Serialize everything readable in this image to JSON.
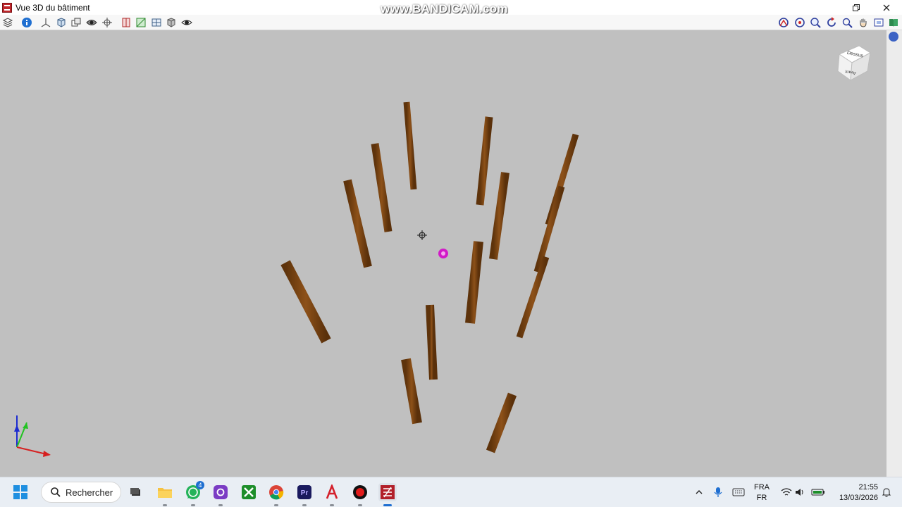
{
  "window": {
    "title": "Vue 3D du bâtiment"
  },
  "watermark": "www.BANDICAM.com",
  "toolbar_left": [
    {
      "icon": "layers-icon"
    },
    {
      "icon": "info-icon"
    },
    {
      "icon": "axes-icon"
    },
    {
      "icon": "box-view-icon"
    },
    {
      "icon": "copy-view-icon"
    },
    {
      "icon": "eye-hide-icon"
    },
    {
      "icon": "walk-icon"
    },
    {
      "icon": "section-icon"
    },
    {
      "icon": "plane-icon"
    },
    {
      "icon": "grid-icon"
    },
    {
      "icon": "cube-icon"
    },
    {
      "icon": "eye-icon"
    }
  ],
  "toolbar_right": [
    {
      "icon": "orbit-icon"
    },
    {
      "icon": "orbit-free-icon"
    },
    {
      "icon": "zoom-icon"
    },
    {
      "icon": "rotate-icon"
    },
    {
      "icon": "zoom-window-icon"
    },
    {
      "icon": "pan-hand-icon"
    },
    {
      "icon": "fit-view-icon"
    },
    {
      "icon": "book-icon"
    }
  ],
  "viewcube": {
    "top_label": "Dessus",
    "front_label": "Avant"
  },
  "colors": {
    "column": "#7a4310",
    "column_light": "#9b5a1f",
    "viewport_bg": "#c0c0c0",
    "pivot": "#d21ac8"
  },
  "taskbar": {
    "search_label": "Rechercher",
    "whatsapp_badge": "4",
    "apps": [
      "windows-start-icon",
      "task-view-icon",
      "file-explorer-icon",
      "whatsapp-icon",
      "instagram-icon",
      "xbox-icon",
      "chrome-icon",
      "premiere-icon",
      "acrobat-icon",
      "record-icon",
      "archicad-icon"
    ],
    "language": "FRA",
    "keyboard": "FR",
    "time": "21:55",
    "date": "13/03/2026"
  }
}
